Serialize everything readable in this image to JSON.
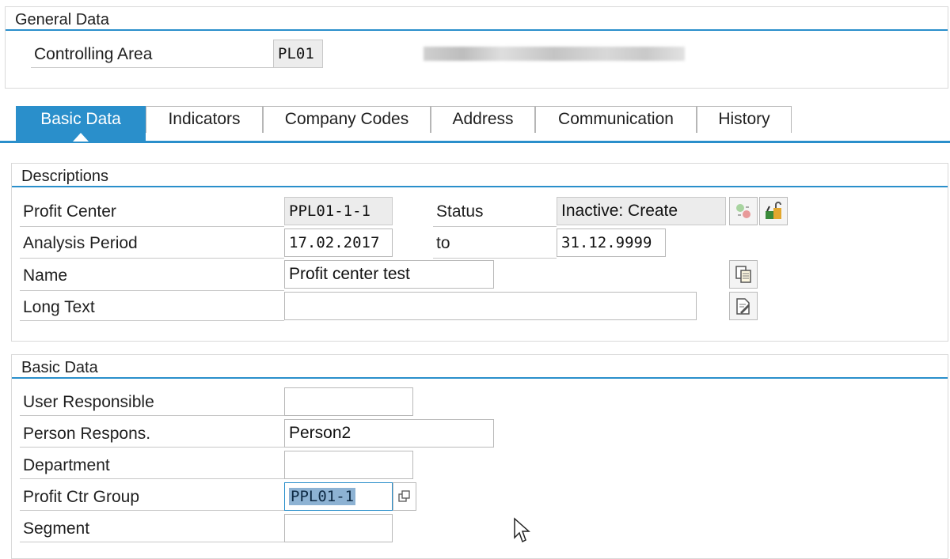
{
  "general": {
    "title": "General Data",
    "controlling_area_label": "Controlling Area",
    "controlling_area_value": "PL01"
  },
  "tabs": [
    {
      "label": "Basic Data",
      "active": true
    },
    {
      "label": "Indicators"
    },
    {
      "label": "Company Codes"
    },
    {
      "label": "Address"
    },
    {
      "label": "Communication"
    },
    {
      "label": "History"
    }
  ],
  "descriptions": {
    "title": "Descriptions",
    "profit_center_label": "Profit Center",
    "profit_center_value": "PPL01-1-1",
    "status_label": "Status",
    "status_value": "Inactive: Create",
    "analysis_period_label": "Analysis Period",
    "analysis_from": "17.02.2017",
    "to_label": "to",
    "analysis_to": "31.12.9999",
    "name_label": "Name",
    "name_value": "Profit center test",
    "long_text_label": "Long Text",
    "long_text_value": ""
  },
  "basic_data": {
    "title": "Basic Data",
    "user_responsible_label": "User Responsible",
    "user_responsible_value": "",
    "person_respons_label": "Person Respons.",
    "person_respons_value": "Person2",
    "department_label": "Department",
    "department_value": "",
    "profit_ctr_group_label": "Profit Ctr Group",
    "profit_ctr_group_value": "PPL01-1",
    "segment_label": "Segment",
    "segment_value": ""
  },
  "icons": {
    "status_activate": "activate-status-icon",
    "status_lock": "lock-change-icon",
    "copy_name": "copy-document-icon",
    "edit_long_text": "edit-text-icon",
    "group_value_help": "value-help-icon"
  }
}
